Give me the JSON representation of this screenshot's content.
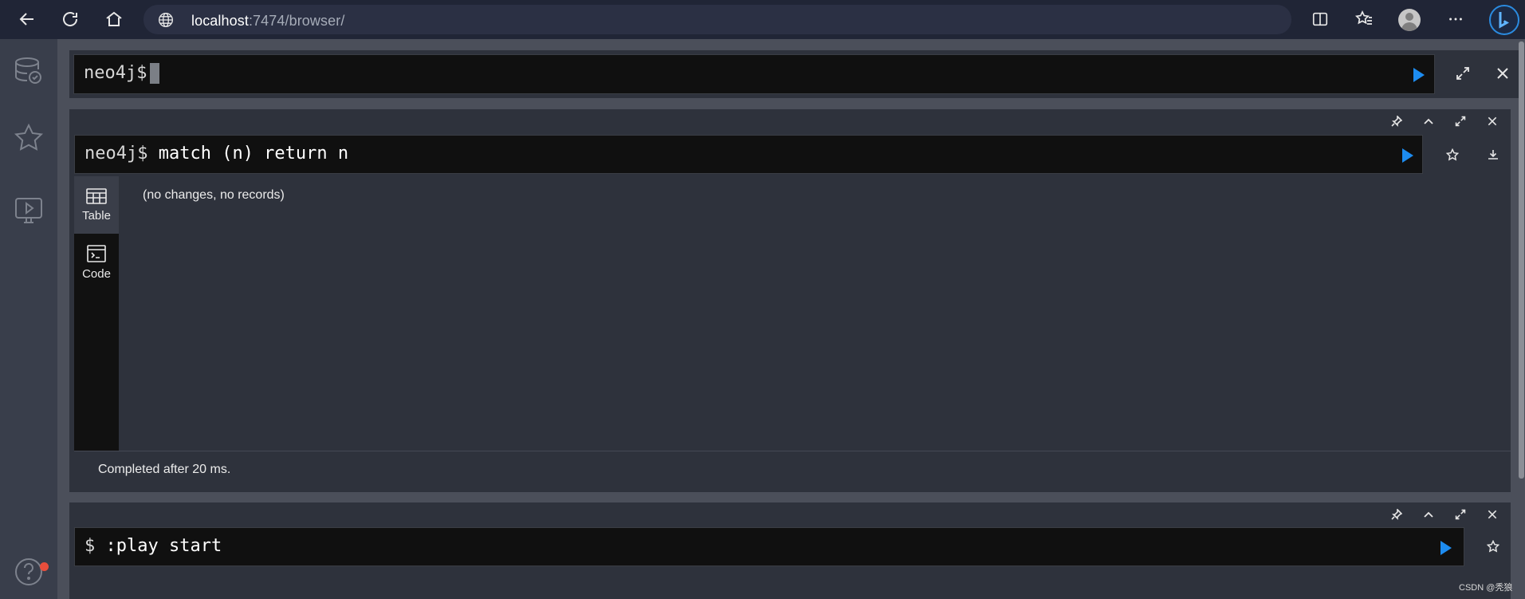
{
  "browser": {
    "url_host": "localhost",
    "url_path": ":7474/browser/"
  },
  "top_editor": {
    "prompt": "neo4j$"
  },
  "frames": [
    {
      "prompt": "neo4j$",
      "command": "match (n) return n",
      "tabs": [
        {
          "label": "Table",
          "icon": "table-icon"
        },
        {
          "label": "Code",
          "icon": "code-icon"
        }
      ],
      "result": "(no changes, no records)",
      "footer": "Completed after 20 ms."
    },
    {
      "prompt": "$",
      "command": ":play start"
    }
  ],
  "watermark": "CSDN @秃狼",
  "colors": {
    "run_button": "#1d8cf0",
    "notification": "#e84e3c"
  }
}
